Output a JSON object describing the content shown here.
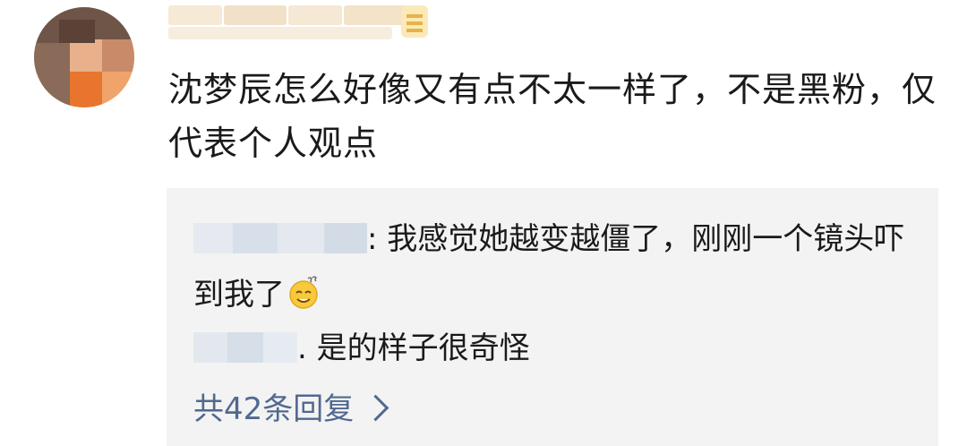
{
  "comment": {
    "text": "沈梦辰怎么好像又有点不太一样了，不是黑粉，仅代表个人观点"
  },
  "replies": [
    {
      "separator": ": ",
      "text": "我感觉她越变越僵了，刚刚一个镜头吓到我了",
      "emoji": "sweat-smile-icon"
    },
    {
      "separator": ". ",
      "text": "是的样子很奇怪"
    }
  ],
  "more_replies": {
    "label": "共42条回复"
  },
  "colors": {
    "link": "#51698f",
    "reply_bg": "#f3f3f3",
    "text": "#1a1a1a"
  }
}
